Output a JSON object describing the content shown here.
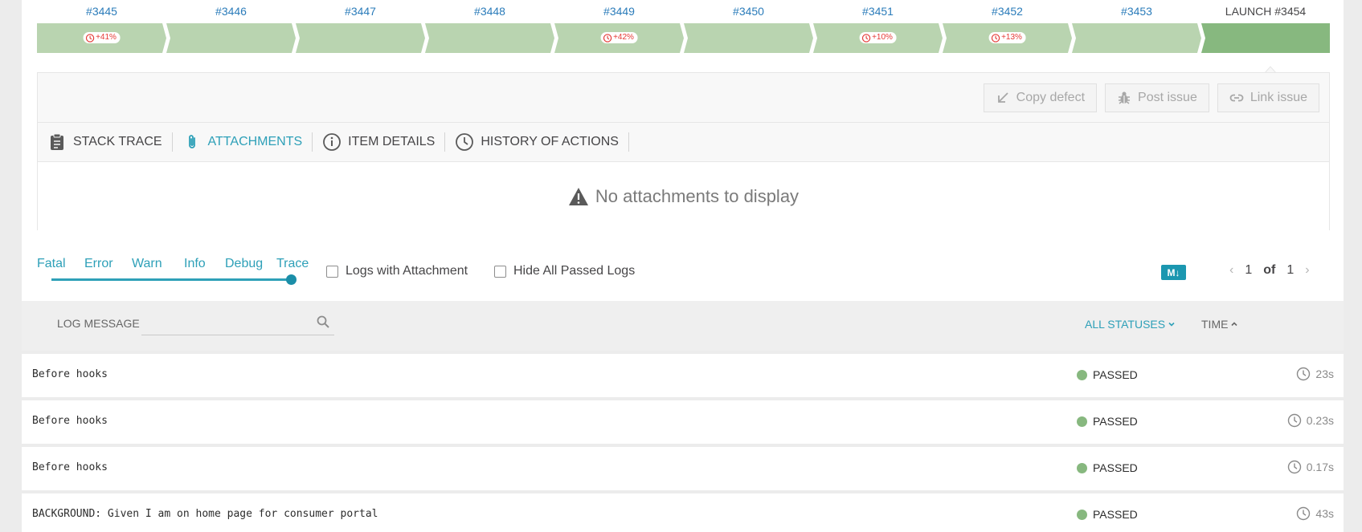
{
  "history": {
    "items": [
      {
        "label": "#3445",
        "badge": "+41%"
      },
      {
        "label": "#3446",
        "badge": ""
      },
      {
        "label": "#3447",
        "badge": ""
      },
      {
        "label": "#3448",
        "badge": ""
      },
      {
        "label": "#3449",
        "badge": "+42%"
      },
      {
        "label": "#3450",
        "badge": ""
      },
      {
        "label": "#3451",
        "badge": "+10%"
      },
      {
        "label": "#3452",
        "badge": "+13%"
      },
      {
        "label": "#3453",
        "badge": ""
      }
    ],
    "current": {
      "label": "LAUNCH #3454"
    },
    "colors": {
      "passed_bar": "#b9d4b0",
      "current_bar": "#87b87f",
      "badge_text": "#e53935"
    }
  },
  "actions": {
    "copy_defect": "Copy defect",
    "post_issue": "Post issue",
    "link_issue": "Link issue"
  },
  "tabs": [
    {
      "label": "STACK TRACE",
      "icon": "clipboard-icon",
      "active": false
    },
    {
      "label": "ATTACHMENTS",
      "icon": "paperclip-icon",
      "active": true
    },
    {
      "label": "ITEM DETAILS",
      "icon": "info-icon",
      "active": false
    },
    {
      "label": "HISTORY OF ACTIONS",
      "icon": "clock-icon",
      "active": false
    }
  ],
  "attachments": {
    "empty_message": "No attachments to display"
  },
  "log_levels": {
    "items": [
      "Fatal",
      "Error",
      "Warn",
      "Info",
      "Debug",
      "Trace"
    ],
    "selected": "Trace"
  },
  "filters": {
    "logs_with_attachment": "Logs with Attachment",
    "hide_all_passed_logs": "Hide All Passed Logs"
  },
  "markdown_toggle": {
    "label": "M↓"
  },
  "pagination": {
    "current": "1",
    "of": "of",
    "total": "1"
  },
  "log_table": {
    "header": {
      "message": "LOG MESSAGE",
      "search_placeholder": "",
      "statuses": "ALL STATUSES",
      "time": "TIME"
    },
    "rows": [
      {
        "message": "Before hooks",
        "status": "PASSED",
        "time": "23s"
      },
      {
        "message": "Before hooks",
        "status": "PASSED",
        "time": "0.23s"
      },
      {
        "message": "Before hooks",
        "status": "PASSED",
        "time": "0.17s"
      },
      {
        "message": "BACKGROUND: Given I am on home page for consumer portal",
        "status": "PASSED",
        "time": "43s"
      }
    ],
    "colors": {
      "passed": "#87b87f",
      "accent": "#2ea0b8"
    }
  }
}
